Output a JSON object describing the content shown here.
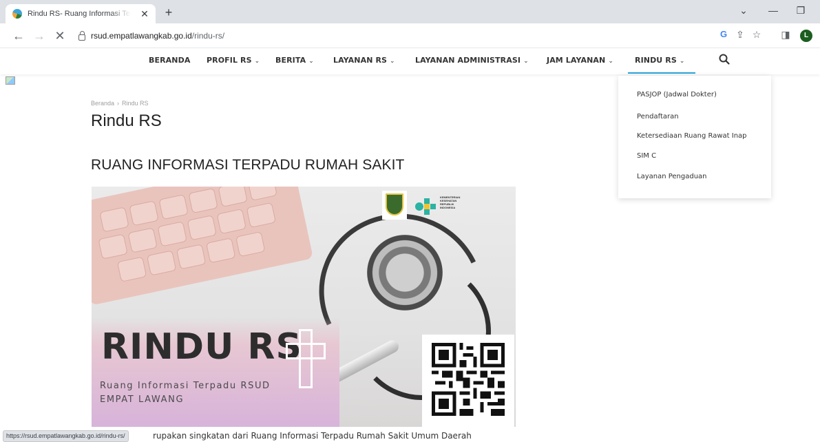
{
  "browser": {
    "tab_title": "Rindu RS- Ruang Informasi Terpa",
    "url_domain": "rsud.empatlawangkab.go.id",
    "url_path": "/rindu-rs/",
    "profile_initial": "L",
    "status_url": "https://rsud.empatlawangkab.go.id/rindu-rs/"
  },
  "nav": {
    "items": [
      {
        "label": "BERANDA"
      },
      {
        "label": "PROFIL RS"
      },
      {
        "label": "BERITA"
      },
      {
        "label": "LAYANAN RS"
      },
      {
        "label": "LAYANAN ADMINISTRASI"
      },
      {
        "label": "JAM LAYANAN"
      },
      {
        "label": "RINDU RS"
      }
    ],
    "active": "RINDU RS",
    "accent_color": "#29a3d9"
  },
  "dropdown": {
    "items": [
      {
        "label": "PASJOP (Jadwal Dokter)"
      },
      {
        "label": "Pendaftaran"
      },
      {
        "label": "Ketersediaan Ruang Rawat Inap"
      },
      {
        "label": "SIM C"
      },
      {
        "label": "Layanan Pengaduan"
      }
    ]
  },
  "page": {
    "breadcrumb": [
      "Beranda",
      "Rindu RS"
    ],
    "title": "Rindu RS",
    "heading": "RUANG INFORMASI TERPADU RUMAH SAKIT",
    "banner_title": "RINDU RS",
    "banner_subtitle_line1": "Ruang Informasi Terpadu RSUD",
    "banner_subtitle_line2": "EMPAT LAWANG",
    "kemkes_text": [
      "KEMENTERIAN",
      "KESEHATAN",
      "REPUBLIK",
      "INDONESIA"
    ],
    "body_text": "rupakan singkatan dari Ruang Informasi Terpadu Rumah Sakit Umum Daerah"
  }
}
